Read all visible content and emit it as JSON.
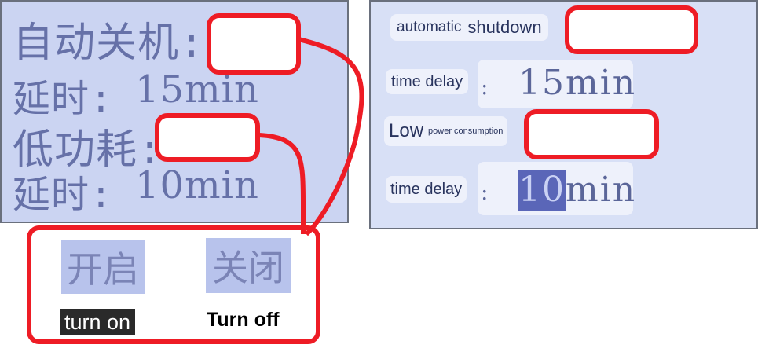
{
  "left_display": {
    "rows": [
      {
        "label": "自动关机:",
        "value": ""
      },
      {
        "label": "延时:",
        "value": "15min"
      },
      {
        "label": "低功耗:",
        "value": ""
      },
      {
        "label": "延时:",
        "value": "10min"
      }
    ]
  },
  "right_display": {
    "auto_shutdown": {
      "word1": "automatic",
      "word2": "shutdown"
    },
    "delay1": {
      "label": "time delay",
      "colon": ":",
      "value": "15min"
    },
    "low_power": {
      "word1": "Low",
      "word2": "power consumption"
    },
    "delay2": {
      "label": "time delay",
      "colon": ":",
      "value_hl": "10",
      "value_rest": "min"
    }
  },
  "options": {
    "on": {
      "glyph": "开启",
      "caption": "turn on"
    },
    "off": {
      "glyph": "关闭",
      "caption": "Turn off"
    }
  },
  "colors": {
    "callout": "#ee1c25",
    "lcd": "#cbd4f2",
    "lcd_text": "#6671a8"
  }
}
